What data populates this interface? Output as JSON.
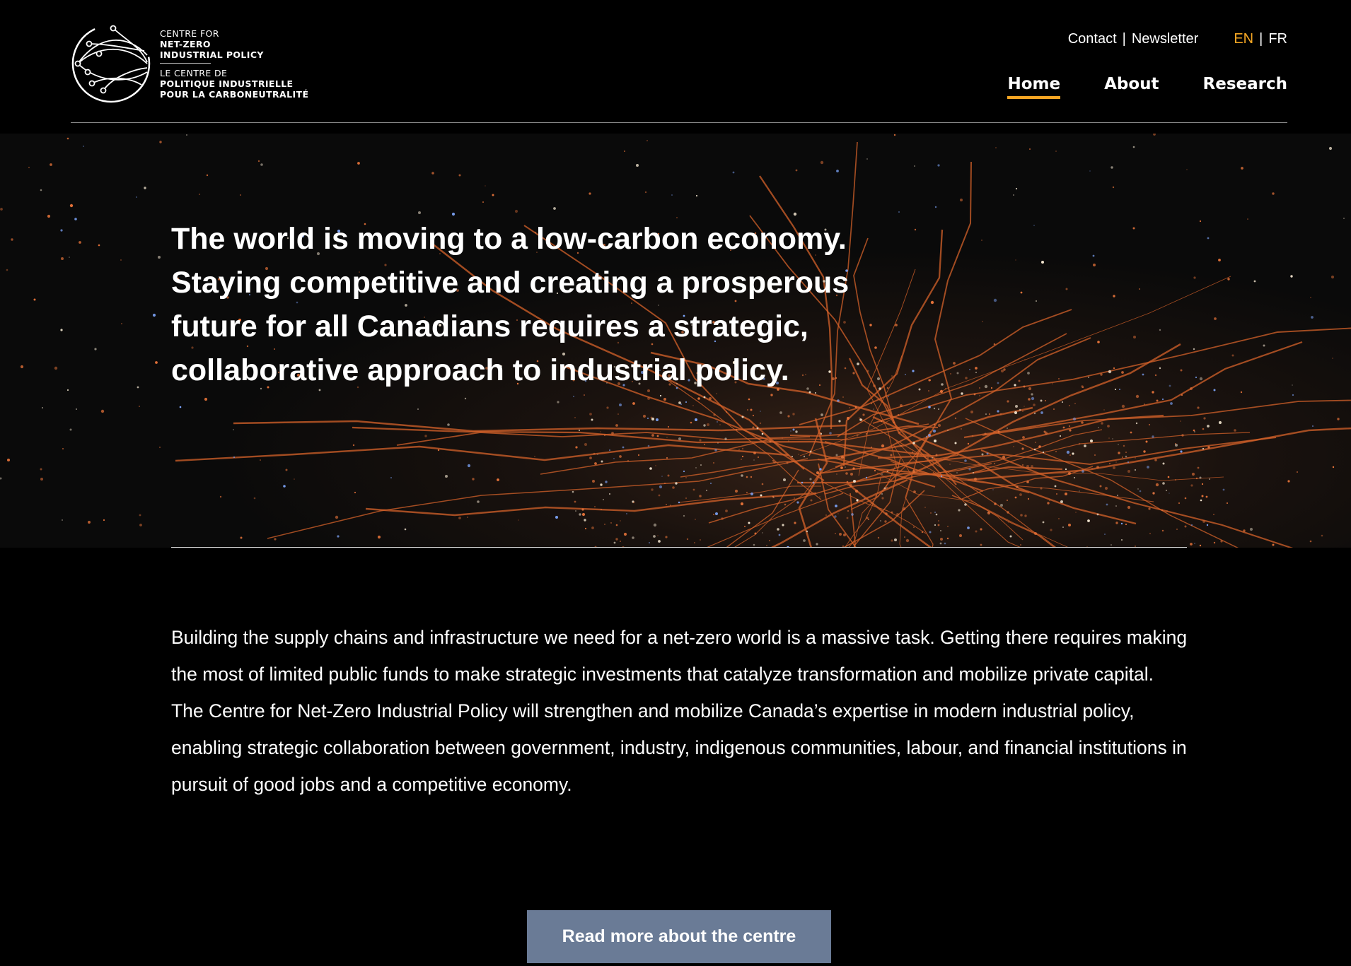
{
  "header": {
    "logo": {
      "en_line1": "CENTRE FOR",
      "en_line2": "NET-ZERO",
      "en_line3": "INDUSTRIAL POLICY",
      "fr_line1": "LE CENTRE DE",
      "fr_line2": "POLITIQUE INDUSTRIELLE",
      "fr_line3": "POUR LA CARBONEUTRALITÉ",
      "icon": "circuit-globe-icon"
    },
    "utility": {
      "contact": "Contact",
      "separator": "|",
      "newsletter": "Newsletter",
      "lang_en": "EN",
      "lang_sep": "|",
      "lang_fr": "FR"
    },
    "nav": [
      {
        "label": "Home",
        "current": true
      },
      {
        "label": "About",
        "current": false
      },
      {
        "label": "Research",
        "current": false
      }
    ]
  },
  "hero": {
    "headline": "The world is moving to a low-carbon economy. Staying competitive and creating a prosperous future for all Canadians requires a strategic, collaborative approach to industrial policy.",
    "background": "night-city-lights-image"
  },
  "intro": {
    "paragraph": "Building the supply chains and infrastructure we need for a net-zero world is a massive task. Getting there requires making the most of limited public funds to make strategic investments that catalyze transformation and mobilize private capital. The Centre for Net-Zero Industrial Policy will strengthen and mobilize Canada’s expertise in modern industrial policy, enabling strategic collaboration between government, industry, indigenous communities, labour, and financial institutions in pursuit of good jobs and a competitive economy."
  },
  "cta": {
    "label": "Read more about the centre"
  },
  "colors": {
    "accent": "#f5a623",
    "button": "#6a7b96",
    "background": "#000000"
  }
}
